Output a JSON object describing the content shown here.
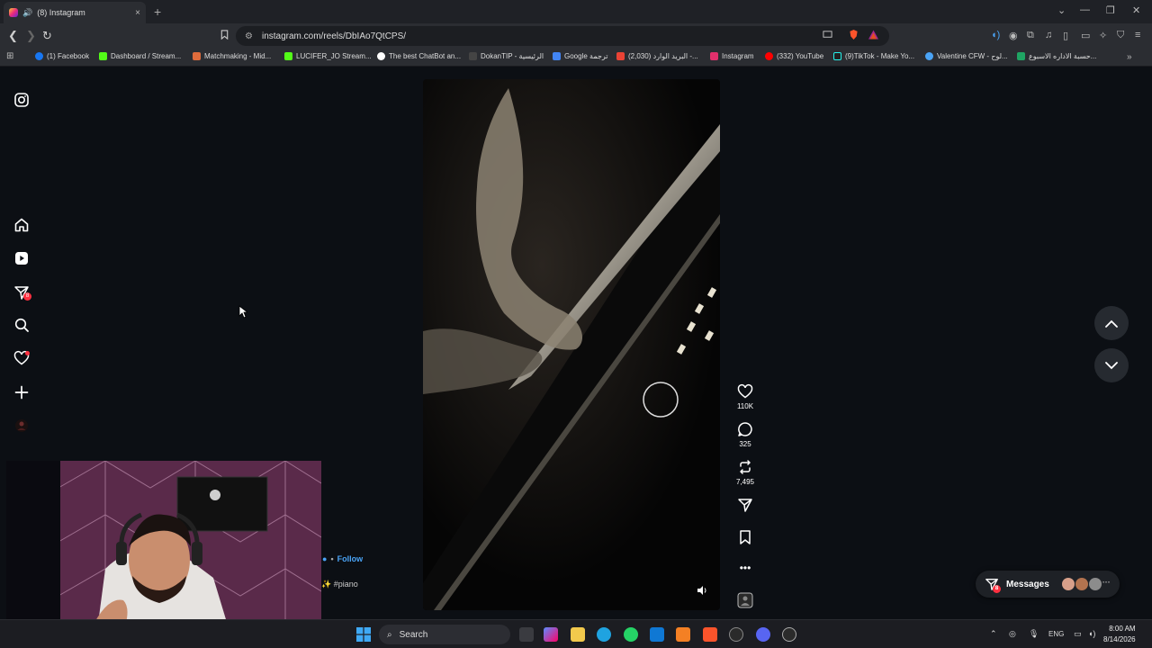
{
  "browser": {
    "tab_title": "(8) Instagram",
    "tab_close": "×",
    "new_tab": "+",
    "url": "instagram.com/reels/DbIAo7QtCPS/",
    "bookmarks": [
      {
        "label": "(1) Facebook",
        "color": "#1877f2"
      },
      {
        "label": "Dashboard / Stream...",
        "color": "#53fc18"
      },
      {
        "label": "Matchmaking - Mid...",
        "color": "#e06c3c"
      },
      {
        "label": "LUCIFER_JO Stream...",
        "color": "#53fc18"
      },
      {
        "label": "The best ChatBot an...",
        "color": "#ffffff"
      },
      {
        "label": "DokanTIP - الرئيسية",
        "color": "#444444"
      },
      {
        "label": "Google ترجمة",
        "color": "#4285f4"
      },
      {
        "label": "(2,030) البريد الوارد -...",
        "color": "#ea4335"
      },
      {
        "label": "Instagram",
        "color": "#e1306c"
      },
      {
        "label": "(332) YouTube",
        "color": "#ff0000"
      },
      {
        "label": "(9)TikTok - Make Yo...",
        "color": "#222222"
      },
      {
        "label": "Valentine CFW - لوح...",
        "color": "#4aa3f5"
      },
      {
        "label": "حسبة الاداره الاسبوع...",
        "color": "#1fa463"
      }
    ]
  },
  "sidebar": {
    "notifications_badge": "8"
  },
  "reel": {
    "likes": "110K",
    "comments": "325",
    "reposts": "7,495",
    "follow_label": "Follow",
    "caption": "#piano"
  },
  "messages": {
    "label": "Messages",
    "badge": "8"
  },
  "taskbar": {
    "search_placeholder": "Search",
    "language": "ENG",
    "time": "8:00 AM",
    "date": "8/14/2026"
  },
  "colors": {
    "accent_blue": "#4aa3f5",
    "badge_red": "#ff3040"
  }
}
